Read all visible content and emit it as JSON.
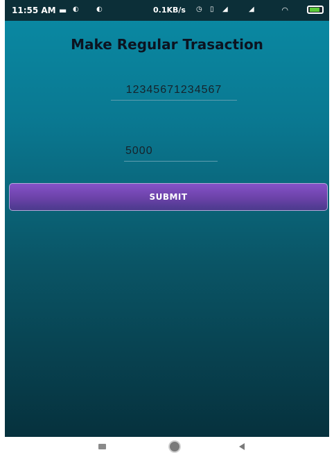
{
  "status_bar": {
    "time": "11:55 AM",
    "network_speed": "0.1KB/s",
    "icons": [
      "message-icon",
      "notification-icon",
      "notification-icon",
      "alarm-icon",
      "vibrate-icon",
      "signal-icon",
      "signal-icon",
      "wifi-icon",
      "battery-icon"
    ]
  },
  "header": {
    "title": "Make Regular Trasaction"
  },
  "form": {
    "account_number": "12345671234567",
    "amount": "5000",
    "submit_label": "SUBMIT"
  },
  "colors": {
    "background_top": "#0a8ba5",
    "background_bottom": "#06313d",
    "button": "#6b42a8",
    "title": "#0c1320"
  },
  "nav_bar": {
    "icons": [
      "recents-icon",
      "home-icon",
      "back-icon"
    ]
  }
}
